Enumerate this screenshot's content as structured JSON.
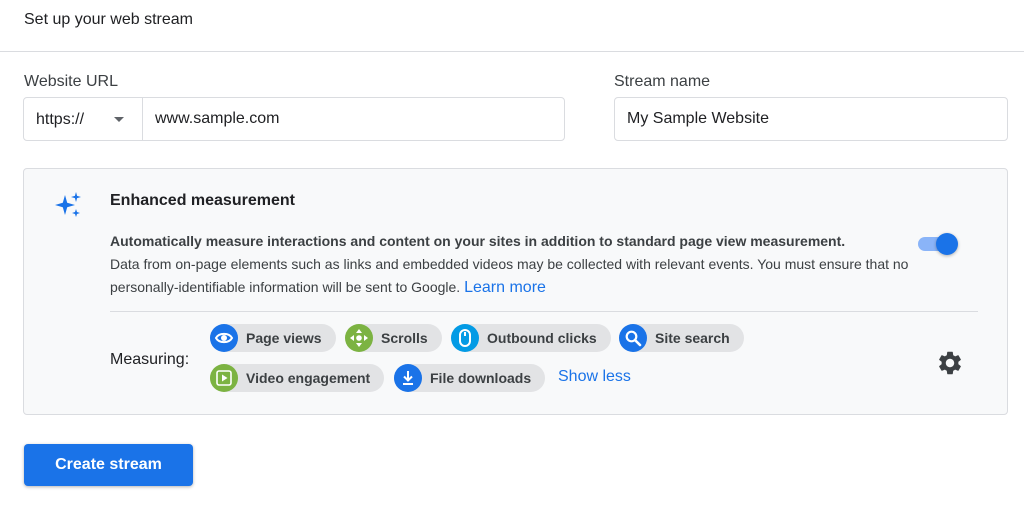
{
  "header": {
    "title": "Set up your web stream"
  },
  "website_url": {
    "label": "Website URL",
    "protocol": "https://",
    "value": "www.sample.com"
  },
  "stream_name": {
    "label": "Stream name",
    "value": "My Sample Website"
  },
  "enhanced": {
    "title": "Enhanced measurement",
    "description_strong": "Automatically measure interactions and content on your sites in addition to standard page view measurement.",
    "description": "Data from on-page elements such as links and embedded videos may be collected with relevant events. You must ensure that no personally-identifiable information will be sent to Google.",
    "learn_more": "Learn more",
    "toggle_on": true,
    "measuring_label": "Measuring:",
    "chips": [
      {
        "label": "Page views",
        "icon": "eye-icon",
        "color": "#1a73e8"
      },
      {
        "label": "Scrolls",
        "icon": "scroll-icon",
        "color": "#7cb342"
      },
      {
        "label": "Outbound clicks",
        "icon": "mouse-icon",
        "color": "#039be5"
      },
      {
        "label": "Site search",
        "icon": "search-icon",
        "color": "#1a73e8"
      },
      {
        "label": "Video engagement",
        "icon": "play-icon",
        "color": "#7cb342"
      },
      {
        "label": "File downloads",
        "icon": "download-icon",
        "color": "#1a73e8"
      }
    ],
    "show_less": "Show less"
  },
  "actions": {
    "create_stream": "Create stream"
  },
  "colors": {
    "accent": "#1a73e8",
    "panel_bg": "#f8f9fa",
    "border": "#dadce0"
  }
}
